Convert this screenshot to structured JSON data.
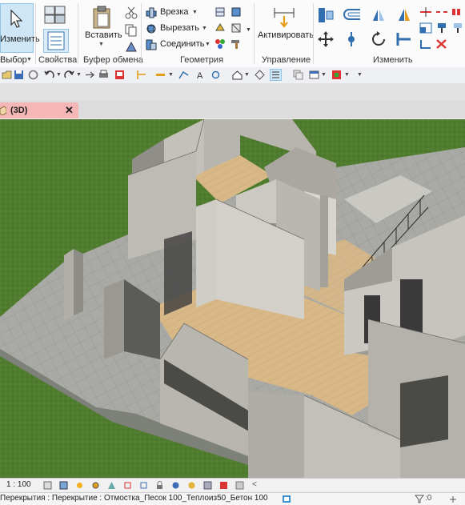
{
  "ribbon": {
    "modify_label": "Изменить",
    "select_label": "Выбор",
    "properties_group": "Свойства",
    "clipboard_group": "Буфер обмена",
    "paste_label": "Вставить",
    "geometry_group": "Геометрия",
    "geometry_items": [
      "Врезка",
      "Вырезать",
      "Соединить"
    ],
    "control_group": "Управление",
    "activate_label": "Активировать",
    "modify_group": "Изменить"
  },
  "tabs": {
    "view_tab_label": "(3D)",
    "close_glyph": "✕"
  },
  "view_control_bar": {
    "scale": "1 : 100"
  },
  "status_bar": {
    "selection_text": "Перекрытия : Перекрытие : Отмостка_Песок 100_Теплоиз50_Бетон 100",
    "filter_count": ":0"
  },
  "colors": {
    "ribbon_active_bg": "#cfe6f7",
    "active_tab_bg": "#f5b6b6",
    "grass": "#4e7a2e",
    "floor": "#d9b98a",
    "wall": "#b7b5ad"
  }
}
